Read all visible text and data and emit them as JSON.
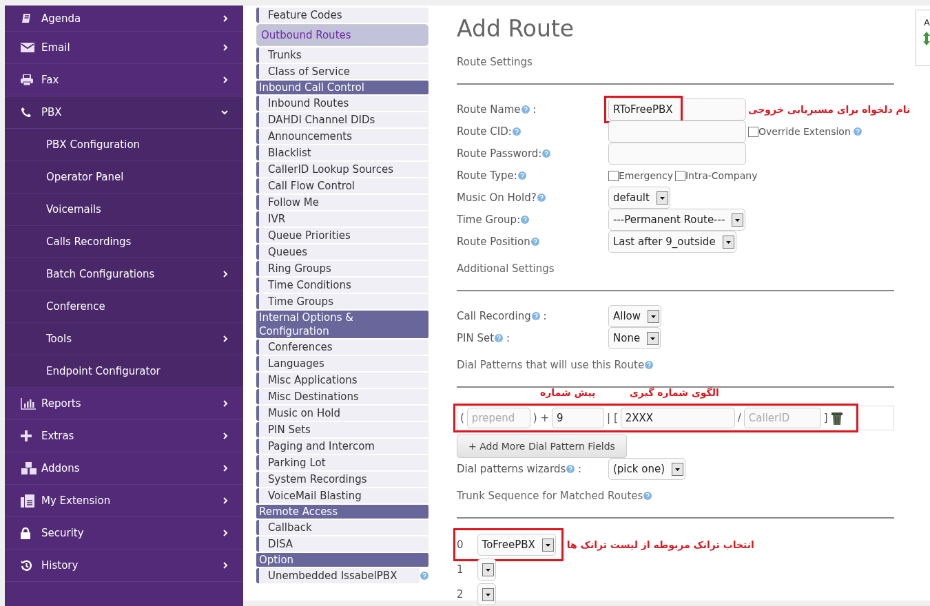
{
  "sidebar": {
    "items": [
      {
        "label": "Agenda",
        "expanded": false
      },
      {
        "label": "Email",
        "expanded": false
      },
      {
        "label": "Fax",
        "expanded": false
      },
      {
        "label": "PBX",
        "expanded": true,
        "children": [
          {
            "label": "PBX Configuration",
            "has_arrow": false
          },
          {
            "label": "Operator Panel",
            "has_arrow": false
          },
          {
            "label": "Voicemails",
            "has_arrow": false
          },
          {
            "label": "Calls Recordings",
            "has_arrow": false
          },
          {
            "label": "Batch Configurations",
            "has_arrow": true
          },
          {
            "label": "Conference",
            "has_arrow": false
          },
          {
            "label": "Tools",
            "has_arrow": true
          },
          {
            "label": "Endpoint Configurator",
            "has_arrow": false
          }
        ]
      },
      {
        "label": "Reports",
        "expanded": false
      },
      {
        "label": "Extras",
        "expanded": false
      },
      {
        "label": "Addons",
        "expanded": false
      },
      {
        "label": "My Extension",
        "expanded": false
      },
      {
        "label": "Security",
        "expanded": false
      },
      {
        "label": "History",
        "expanded": false
      }
    ]
  },
  "module_nav": [
    {
      "kind": "link",
      "label": "Feature Codes",
      "selected": false
    },
    {
      "kind": "link",
      "label": "Outbound Routes",
      "selected": true
    },
    {
      "kind": "link",
      "label": "Trunks",
      "selected": false
    },
    {
      "kind": "link",
      "label": "Class of Service",
      "selected": false
    },
    {
      "kind": "header",
      "label": "Inbound Call Control"
    },
    {
      "kind": "link",
      "label": "Inbound Routes",
      "selected": false
    },
    {
      "kind": "link",
      "label": "DAHDI Channel DIDs",
      "selected": false
    },
    {
      "kind": "link",
      "label": "Announcements",
      "selected": false
    },
    {
      "kind": "link",
      "label": "Blacklist",
      "selected": false
    },
    {
      "kind": "link",
      "label": "CallerID Lookup Sources",
      "selected": false
    },
    {
      "kind": "link",
      "label": "Call Flow Control",
      "selected": false
    },
    {
      "kind": "link",
      "label": "Follow Me",
      "selected": false
    },
    {
      "kind": "link",
      "label": "IVR",
      "selected": false
    },
    {
      "kind": "link",
      "label": "Queue Priorities",
      "selected": false
    },
    {
      "kind": "link",
      "label": "Queues",
      "selected": false
    },
    {
      "kind": "link",
      "label": "Ring Groups",
      "selected": false
    },
    {
      "kind": "link",
      "label": "Time Conditions",
      "selected": false
    },
    {
      "kind": "link",
      "label": "Time Groups",
      "selected": false
    },
    {
      "kind": "header",
      "label": "Internal Options & Configuration"
    },
    {
      "kind": "link",
      "label": "Conferences",
      "selected": false
    },
    {
      "kind": "link",
      "label": "Languages",
      "selected": false
    },
    {
      "kind": "link",
      "label": "Misc Applications",
      "selected": false
    },
    {
      "kind": "link",
      "label": "Misc Destinations",
      "selected": false
    },
    {
      "kind": "link",
      "label": "Music on Hold",
      "selected": false
    },
    {
      "kind": "link",
      "label": "PIN Sets",
      "selected": false
    },
    {
      "kind": "link",
      "label": "Paging and Intercom",
      "selected": false
    },
    {
      "kind": "link",
      "label": "Parking Lot",
      "selected": false
    },
    {
      "kind": "link",
      "label": "System Recordings",
      "selected": false
    },
    {
      "kind": "link",
      "label": "VoiceMail Blasting",
      "selected": false
    },
    {
      "kind": "header",
      "label": "Remote Access"
    },
    {
      "kind": "link",
      "label": "Callback",
      "selected": false
    },
    {
      "kind": "link",
      "label": "DISA",
      "selected": false
    },
    {
      "kind": "header",
      "label": "Option"
    },
    {
      "kind": "link",
      "label": "Unembedded IssabelPBX",
      "selected": false,
      "help": true
    }
  ],
  "form": {
    "title": "Add Route",
    "blocks": [
      {
        "kind": "section",
        "label": "Route Settings"
      },
      {
        "kind": "input",
        "label": "Route Name",
        "suffix": ":",
        "value": "RToFreePBX",
        "highlighted": true,
        "annotation": "نام دلخواه برای مسیریابی خروجی"
      },
      {
        "kind": "input",
        "label": "Route CID:",
        "check": {
          "label": "Override Extension",
          "checked": false
        }
      },
      {
        "kind": "input",
        "label": "Route Password:"
      },
      {
        "kind": "checks",
        "label": "Route Type:",
        "checks": [
          {
            "label": "Emergency",
            "checked": false
          },
          {
            "label": "Intra-Company",
            "checked": false
          }
        ]
      },
      {
        "kind": "select",
        "label": "Music On Hold?",
        "value": "default"
      },
      {
        "kind": "select",
        "label": "Time Group:",
        "value": "---Permanent Route---"
      },
      {
        "kind": "select",
        "label": "Route Position",
        "value": "Last after 9_outside"
      },
      {
        "kind": "section",
        "label": "Additional Settings"
      },
      {
        "kind": "select",
        "label": "Call Recording",
        "suffix": ":",
        "value": "Allow"
      },
      {
        "kind": "select",
        "label": "PIN Set",
        "suffix": ":",
        "value": "None"
      },
      {
        "kind": "section",
        "label": "Dial Patterns that will use this Route",
        "help": true
      },
      {
        "kind": "patterns",
        "highlighted": true,
        "prepend_annotation": "پیش شماره",
        "pattern_annotation": "الگوی شماره گیری",
        "open": "(",
        "prepend_placeholder": "prepend",
        "plus": ") +",
        "prefix": "9",
        "bar": "| [",
        "pattern": "2XXX",
        "slash": "/",
        "callerid_placeholder": "CallerID",
        "close": "]"
      },
      {
        "kind": "button",
        "label": "+ Add More Dial Pattern Fields"
      },
      {
        "kind": "select",
        "label": "Dial patterns wizards",
        "suffix": ":",
        "value": "(pick one)"
      },
      {
        "kind": "section",
        "label": "Trunk Sequence for Matched Routes",
        "help": true
      },
      {
        "kind": "trunks",
        "annotation": "انتخاب ترانک مربوطه از لیست ترانک ها",
        "trunks": [
          {
            "index": "0",
            "value": "ToFreePBX",
            "highlighted": true
          },
          {
            "index": "1"
          },
          {
            "index": "2"
          }
        ]
      }
    ]
  },
  "side_widget": {
    "label": "A"
  }
}
